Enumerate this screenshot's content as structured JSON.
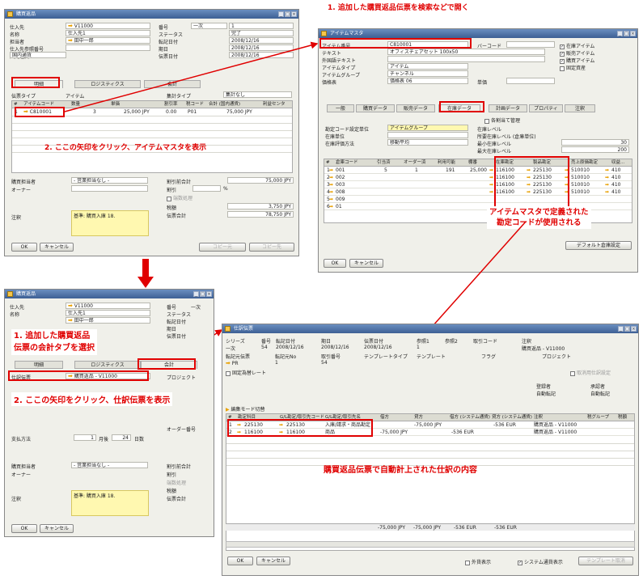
{
  "top_annotation": "1. 追加した購買返品伝票を検索などで開く",
  "ann2": "2. ここの矢印をクリック、アイテムマスタを表示",
  "ann3": "アイテムマスタで定義された\n勘定コードが使用される",
  "ann4a": "1. 追加した購買返品\n伝票の会計タブを選択",
  "ann4b": "2. ここの矢印をクリック、仕訳伝票を表示",
  "ann5": "購買返品伝票で自動計上された仕訳の内容",
  "w1": {
    "title": "購買返品",
    "labels": [
      "仕入先",
      "名称",
      "担当者",
      "仕入先参照番号",
      "国内通貨"
    ],
    "values": [
      "V11000",
      "仕入先1",
      "田中一郎",
      "",
      ""
    ],
    "rlabels": [
      "番号",
      "ステータス",
      "転記日付",
      "期日",
      "伝票日付"
    ],
    "series": "一次",
    "rvalues": [
      "1",
      "完了",
      "2008/12/16",
      "2008/12/16",
      "2008/12/16"
    ],
    "tabs": [
      "明細",
      "ロジスティクス",
      "会計"
    ],
    "item_type_label": "伝票タイプ",
    "item_type_val": "アイテム",
    "sum_type_label": "集計タイプ",
    "sum_type_val": "集計なし",
    "cols": [
      "#",
      "アイテムコード",
      "数量",
      "単価",
      "割引率",
      "税コード",
      "合計 (国内通貨)",
      "利益センタ"
    ],
    "row": [
      "1",
      "C810001",
      "3",
      "25,000 JPY",
      "0.00",
      "P01",
      "75,000 JPY",
      ""
    ],
    "buyer_label": "購買担当者",
    "buyer_val": "- 営業担当なし -",
    "owner_label": "オーナー",
    "sub_label": "割引前合計",
    "sub_val": "75,000 JPY",
    "disc_label": "割引",
    "pct": "%",
    "tax_label": "税額",
    "tax_val": "3,750 JPY",
    "total_label": "伝票合計",
    "total_val": "78,750 JPY",
    "remarks_label": "注釈",
    "remarks": "基準: 購買入庫 18.",
    "ok": "OK",
    "cancel": "キャンセル",
    "copyfrom": "コピー元",
    "copyto": "コピー先",
    "round": "端数処理"
  },
  "w2": {
    "title": "アイテムマスタ",
    "labels": [
      "アイテム番号",
      "テキスト",
      "外国語テキスト",
      "アイテムタイプ",
      "アイテムグループ",
      "価格表"
    ],
    "values": [
      "C810001",
      "オフィスチェアセット 100x50",
      "",
      "アイテム",
      "チャンネル",
      "価格表 06"
    ],
    "barcode_label": "バーコード",
    "unit_price": "単価",
    "checks": [
      "在庫アイテム",
      "販売アイテム",
      "購買アイテム",
      "固定資産"
    ],
    "checks_on": [
      true,
      true,
      true,
      false
    ],
    "tabs": [
      "一般",
      "購買データ",
      "販売データ",
      "在庫データ",
      "計画データ",
      "プロパティ",
      "注釈"
    ],
    "serial": "各割当て管理",
    "left_labels": [
      "勘定コード設定単位",
      "在庫単位",
      "在庫評価方法"
    ],
    "left_vals": [
      "アイテムグループ",
      "",
      "移動平均"
    ],
    "right_labels": [
      "在庫レベル",
      "所要在庫レベル (倉庫単位)",
      "最小在庫レベル",
      "最大在庫レベル"
    ],
    "right_vals": [
      "",
      "",
      "30",
      "200"
    ],
    "cols": [
      "#",
      "倉庫コード",
      "引当済",
      "オーダー済",
      "利用可能",
      "棚番",
      "在庫勘定",
      "製品勘定",
      "売上原価勘定",
      "収益..."
    ],
    "rows": [
      [
        "1",
        "001",
        "5",
        "1",
        "191",
        "25,000",
        "116100",
        "225130",
        "510010",
        "410"
      ],
      [
        "2",
        "002",
        "",
        "",
        "",
        "",
        "116100",
        "225130",
        "510010",
        "410"
      ],
      [
        "3",
        "003",
        "",
        "",
        "",
        "",
        "116100",
        "225130",
        "510010",
        "410"
      ],
      [
        "4",
        "008",
        "",
        "",
        "",
        "",
        "116100",
        "225130",
        "510010",
        "410"
      ],
      [
        "5",
        "009",
        "",
        "",
        "",
        "",
        "",
        "",
        "",
        ""
      ],
      [
        "6",
        "01",
        "",
        "",
        "",
        "",
        "",
        "",
        "",
        ""
      ]
    ],
    "ok": "OK",
    "cancel": "キャンセル",
    "default_btn": "デフォルト倉庫設定"
  },
  "w3": {
    "title": "購買返品",
    "tabs": [
      "明細",
      "ロジスティクス",
      "会計"
    ],
    "je_label": "仕訳伝票",
    "je_val": "購買返品 - V11000",
    "proj": "プロジェクト",
    "mode_label": "支払方法",
    "due_label": "月後",
    "due_num": "1",
    "days": "24",
    "days_label": "日数",
    "order": "オーダー番号",
    "ok": "OK",
    "cancel": "キャンセル"
  },
  "w4": {
    "title": "仕訳伝票",
    "h_labels": [
      "シリーズ",
      "番号",
      "転記日付",
      "期日",
      "伝票日付",
      "参照1",
      "参照2",
      "取引コード",
      "注釈"
    ],
    "h_vals": [
      "一次",
      "54",
      "2008/12/16",
      "2008/12/16",
      "2008/12/16",
      "1",
      "",
      "",
      "購買返品 - V11000"
    ],
    "origin_label": "転記元伝票",
    "origin_val": "PR",
    "orig_no_label": "転記元No",
    "orig_no": "1",
    "trans_label": "取引番号",
    "trans_no": "54",
    "tmpl_type": "テンプレートタイプ",
    "tmpl": "テンプレート",
    "flag": "フラグ",
    "proj": "プロジェクト",
    "fixrate": "固定為替レート",
    "corr": "取消用仕訳設定",
    "reg_label": "登録者",
    "reg_val": "自動転記",
    "approver_label": "承認者",
    "approver_val": "自動転記",
    "mode": "編集モード切替",
    "cols": [
      "#",
      "勘定科目",
      "G/L勘定/取引先コード",
      "G/L勘定/取引先名",
      "借方",
      "貸方",
      "借方 (システム通貨)",
      "貸方 (システム通貨)",
      "注釈",
      "税グループ",
      "税額"
    ],
    "rows": [
      [
        "1",
        "225130",
        "225130",
        "入庫/請求・商品勘定",
        "",
        "-75,000 JPY",
        "",
        "-536 EUR",
        "購買返品 - V11000",
        "",
        ""
      ],
      [
        "2",
        "116100",
        "116100",
        "商品",
        "-75,000 JPY",
        "",
        "-536 EUR",
        "",
        "購買返品 - V11000",
        "",
        ""
      ]
    ],
    "totals": [
      "-75,000 JPY",
      "-75,000 JPY",
      "-536 EUR",
      "-536 EUR"
    ],
    "ok": "OK",
    "cancel": "キャンセル",
    "show_fc": "外貨表示",
    "show_sys": "システム通貨表示",
    "tmpl_btn": "テンプレート取消"
  }
}
